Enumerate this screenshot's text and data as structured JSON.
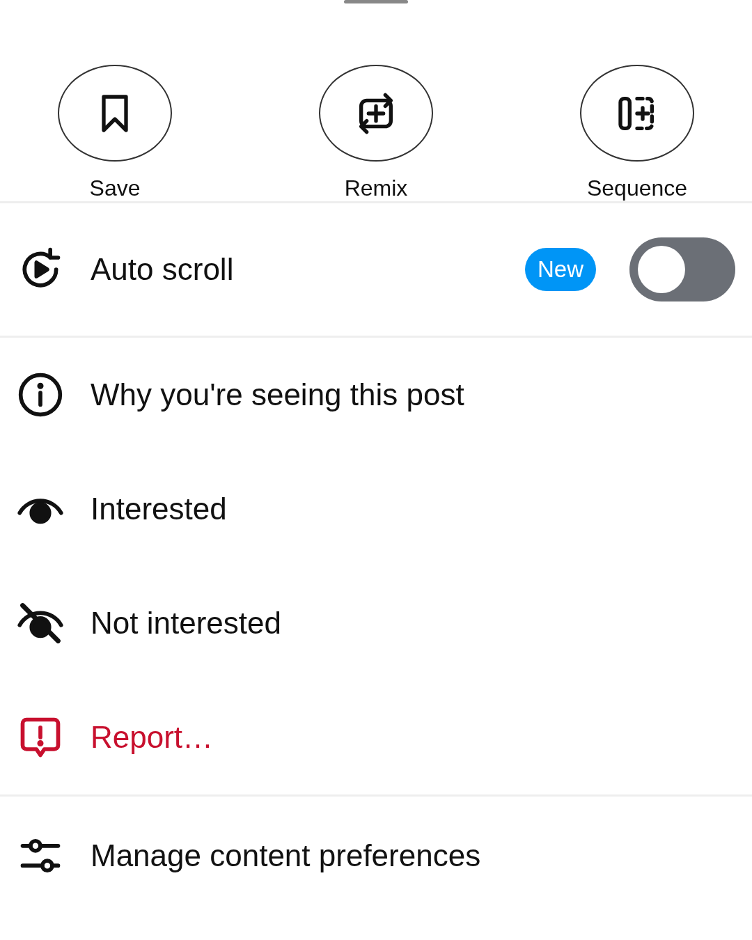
{
  "actions": [
    {
      "label": "Save",
      "kind": "save"
    },
    {
      "label": "Remix",
      "kind": "remix"
    },
    {
      "label": "Sequence",
      "kind": "sequence"
    }
  ],
  "auto_scroll": {
    "label": "Auto scroll",
    "badge": "New",
    "on": false
  },
  "menu": [
    {
      "label": "Why you're seeing this post",
      "kind": "info"
    },
    {
      "label": "Interested",
      "kind": "interested"
    },
    {
      "label": "Not interested",
      "kind": "not-interested"
    },
    {
      "label": "Report…",
      "kind": "report"
    }
  ],
  "footer": {
    "label": "Manage content preferences",
    "kind": "preferences"
  }
}
